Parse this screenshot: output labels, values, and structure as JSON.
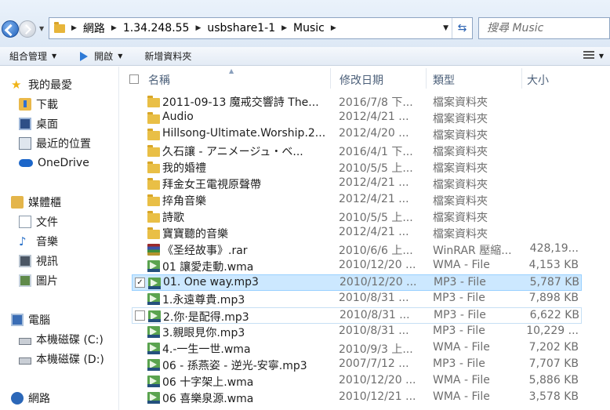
{
  "address": {
    "crumbs": [
      "網路",
      "1.34.248.55",
      "usbshare1-1",
      "Music"
    ]
  },
  "search": {
    "placeholder": "搜尋 Music"
  },
  "toolbar": {
    "organize": "組合管理",
    "open": "開啟",
    "new_folder": "新增資料夾"
  },
  "sidebar": {
    "favorites": "我的最愛",
    "favorites_items": [
      "下載",
      "桌面",
      "最近的位置",
      "OneDrive"
    ],
    "libraries": "媒體櫃",
    "library_items": [
      "文件",
      "音樂",
      "視訊",
      "圖片"
    ],
    "computer": "電腦",
    "computer_items": [
      "本機磁碟 (C:)",
      "本機磁碟 (D:)"
    ],
    "network": "網路"
  },
  "columns": {
    "name": "名稱",
    "date": "修改日期",
    "type": "類型",
    "size": "大小"
  },
  "files": [
    {
      "icon": "folder",
      "name": "2011-09-13 魔戒交響詩 The...",
      "date": "2016/7/8 下...",
      "type": "檔案資料夾",
      "size": ""
    },
    {
      "icon": "folder",
      "name": "Audio",
      "date": "2012/4/21 ...",
      "type": "檔案資料夾",
      "size": ""
    },
    {
      "icon": "folder",
      "name": "Hillsong-Ultimate.Worship.2...",
      "date": "2012/4/20 ...",
      "type": "檔案資料夾",
      "size": ""
    },
    {
      "icon": "folder",
      "name": "久石讓 - アニメージュ・ベ...",
      "date": "2016/4/1 下...",
      "type": "檔案資料夾",
      "size": ""
    },
    {
      "icon": "folder",
      "name": "我的婚禮",
      "date": "2010/5/5 上...",
      "type": "檔案資料夾",
      "size": ""
    },
    {
      "icon": "folder",
      "name": "拜金女王電視原聲帶",
      "date": "2012/4/21 ...",
      "type": "檔案資料夾",
      "size": ""
    },
    {
      "icon": "folder",
      "name": "捽角音樂",
      "date": "2012/4/21 ...",
      "type": "檔案資料夾",
      "size": ""
    },
    {
      "icon": "folder",
      "name": "詩歌",
      "date": "2010/5/5 上...",
      "type": "檔案資料夾",
      "size": ""
    },
    {
      "icon": "folder",
      "name": "寶寶聽的音樂",
      "date": "2012/4/21 ...",
      "type": "檔案資料夾",
      "size": ""
    },
    {
      "icon": "rar",
      "name": "《圣经故事》.rar",
      "date": "2010/6/6 上...",
      "type": "WinRAR 壓縮...",
      "size": "428,19..."
    },
    {
      "icon": "media",
      "name": "01 讓愛走動.wma",
      "date": "2010/12/20 ...",
      "type": "WMA - File",
      "size": "4,153 KB"
    },
    {
      "icon": "media",
      "name": "01. One way.mp3",
      "date": "2010/12/20 ...",
      "type": "MP3 - File",
      "size": "5,787 KB",
      "state": "selected"
    },
    {
      "icon": "media",
      "name": "1.永遠尊貴.mp3",
      "date": "2010/8/31 ...",
      "type": "MP3 - File",
      "size": "7,898 KB"
    },
    {
      "icon": "media",
      "name": "2.你·是配得.mp3",
      "date": "2010/8/31 ...",
      "type": "MP3 - File",
      "size": "6,622 KB",
      "state": "hover"
    },
    {
      "icon": "media",
      "name": "3.親眼見你.mp3",
      "date": "2010/8/31 ...",
      "type": "MP3 - File",
      "size": "10,229 ..."
    },
    {
      "icon": "media",
      "name": "4.-一生一世.wma",
      "date": "2010/9/3 上...",
      "type": "WMA - File",
      "size": "7,202 KB"
    },
    {
      "icon": "media",
      "name": "06 - 孫燕姿 - 逆光-安寧.mp3",
      "date": "2007/7/12 ...",
      "type": "MP3 - File",
      "size": "7,707 KB"
    },
    {
      "icon": "media",
      "name": "06 十字架上.wma",
      "date": "2010/12/20 ...",
      "type": "WMA - File",
      "size": "5,886 KB"
    },
    {
      "icon": "media",
      "name": "06 喜樂泉源.wma",
      "date": "2010/12/21 ...",
      "type": "WMA - File",
      "size": "3,578 KB"
    }
  ]
}
